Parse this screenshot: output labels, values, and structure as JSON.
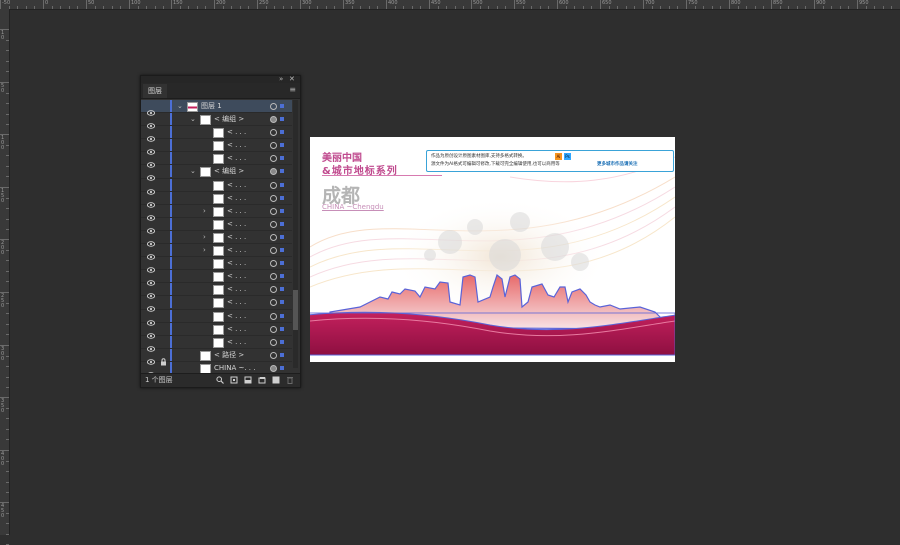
{
  "ruler": {
    "top_labels": [
      "-50",
      "0",
      "50",
      "100",
      "150",
      "200",
      "250",
      "300",
      "350",
      "400",
      "450",
      "500",
      "550",
      "600",
      "650",
      "700",
      "750",
      "800",
      "850",
      "900",
      "950"
    ],
    "left_labels": [
      "1 0",
      "5 0",
      "1 0 0",
      "1 5 0",
      "2 0 0",
      "2 5 0",
      "3 0 0",
      "3 5 0",
      "4 0 0",
      "4 5 0"
    ]
  },
  "panel": {
    "title": "图层",
    "collapse_glyph": "»",
    "close_glyph": "✕",
    "menu_glyph": "≡",
    "footer_count": "1 个图层",
    "footer_icons": [
      "search-icon",
      "export-icon",
      "clip-icon",
      "new-sublayer-icon",
      "new-layer-icon",
      "delete-icon"
    ],
    "rows": [
      {
        "label": "图层 1",
        "indent": 0,
        "arrow": "⌄",
        "locked": false,
        "selected": true,
        "target_filled": false
      },
      {
        "label": "< 编组 >",
        "indent": 1,
        "arrow": "⌄",
        "locked": false,
        "selected": false,
        "target_filled": true
      },
      {
        "label": "< . . .",
        "indent": 2,
        "arrow": "",
        "locked": false,
        "selected": false,
        "target_filled": false
      },
      {
        "label": "< . . .",
        "indent": 2,
        "arrow": "",
        "locked": false,
        "selected": false,
        "target_filled": false
      },
      {
        "label": "< . . .",
        "indent": 2,
        "arrow": "",
        "locked": false,
        "selected": false,
        "target_filled": false
      },
      {
        "label": "< 编组 >",
        "indent": 1,
        "arrow": "⌄",
        "locked": false,
        "selected": false,
        "target_filled": true
      },
      {
        "label": "< . . .",
        "indent": 2,
        "arrow": "",
        "locked": false,
        "selected": false,
        "target_filled": false
      },
      {
        "label": "< . . .",
        "indent": 2,
        "arrow": "",
        "locked": false,
        "selected": false,
        "target_filled": false
      },
      {
        "label": "< . . .",
        "indent": 2,
        "arrow": "›",
        "locked": false,
        "selected": false,
        "target_filled": false
      },
      {
        "label": "< . . .",
        "indent": 2,
        "arrow": "",
        "locked": false,
        "selected": false,
        "target_filled": false
      },
      {
        "label": "< . . .",
        "indent": 2,
        "arrow": "›",
        "locked": false,
        "selected": false,
        "target_filled": false
      },
      {
        "label": "< . . .",
        "indent": 2,
        "arrow": "›",
        "locked": false,
        "selected": false,
        "target_filled": false
      },
      {
        "label": "< . . .",
        "indent": 2,
        "arrow": "",
        "locked": false,
        "selected": false,
        "target_filled": false
      },
      {
        "label": "< . . .",
        "indent": 2,
        "arrow": "",
        "locked": false,
        "selected": false,
        "target_filled": false
      },
      {
        "label": "< . . .",
        "indent": 2,
        "arrow": "",
        "locked": false,
        "selected": false,
        "target_filled": false
      },
      {
        "label": "< . . .",
        "indent": 2,
        "arrow": "",
        "locked": false,
        "selected": false,
        "target_filled": false
      },
      {
        "label": "< . . .",
        "indent": 2,
        "arrow": "",
        "locked": false,
        "selected": false,
        "target_filled": false
      },
      {
        "label": "< . . .",
        "indent": 2,
        "arrow": "",
        "locked": false,
        "selected": false,
        "target_filled": false
      },
      {
        "label": "< . . .",
        "indent": 2,
        "arrow": "",
        "locked": false,
        "selected": false,
        "target_filled": false
      },
      {
        "label": "< 路径 >",
        "indent": 1,
        "arrow": "",
        "locked": true,
        "selected": false,
        "target_filled": false
      },
      {
        "label": "CHINA ~. . .",
        "indent": 1,
        "arrow": "",
        "locked": false,
        "selected": false,
        "target_filled": true
      }
    ]
  },
  "artboard": {
    "title_line1": "美丽中国",
    "title_line2": "&城市地标系列",
    "info_line1": "作品为原创设计原图素材图库,支持多格式转换。",
    "info_line2": "源文件为AI格式可编辑可修改,下载可完全编辑使用,也可以商用等",
    "info_more": "更多城市作品请关注",
    "badge_ai": "Ai",
    "badge_ps": "Ps",
    "city_cn": "成都",
    "city_en": "CHINA ~Chengdu"
  },
  "colors": {
    "workspace": "#2e2e2e",
    "panel_bg": "#323232",
    "selection_blue": "#4c6fd6",
    "band": "#a8124d",
    "skyline_top": "#e86a6a",
    "skyline_bottom": "#f7d9d9",
    "accent_pink": "#c04a8e"
  }
}
